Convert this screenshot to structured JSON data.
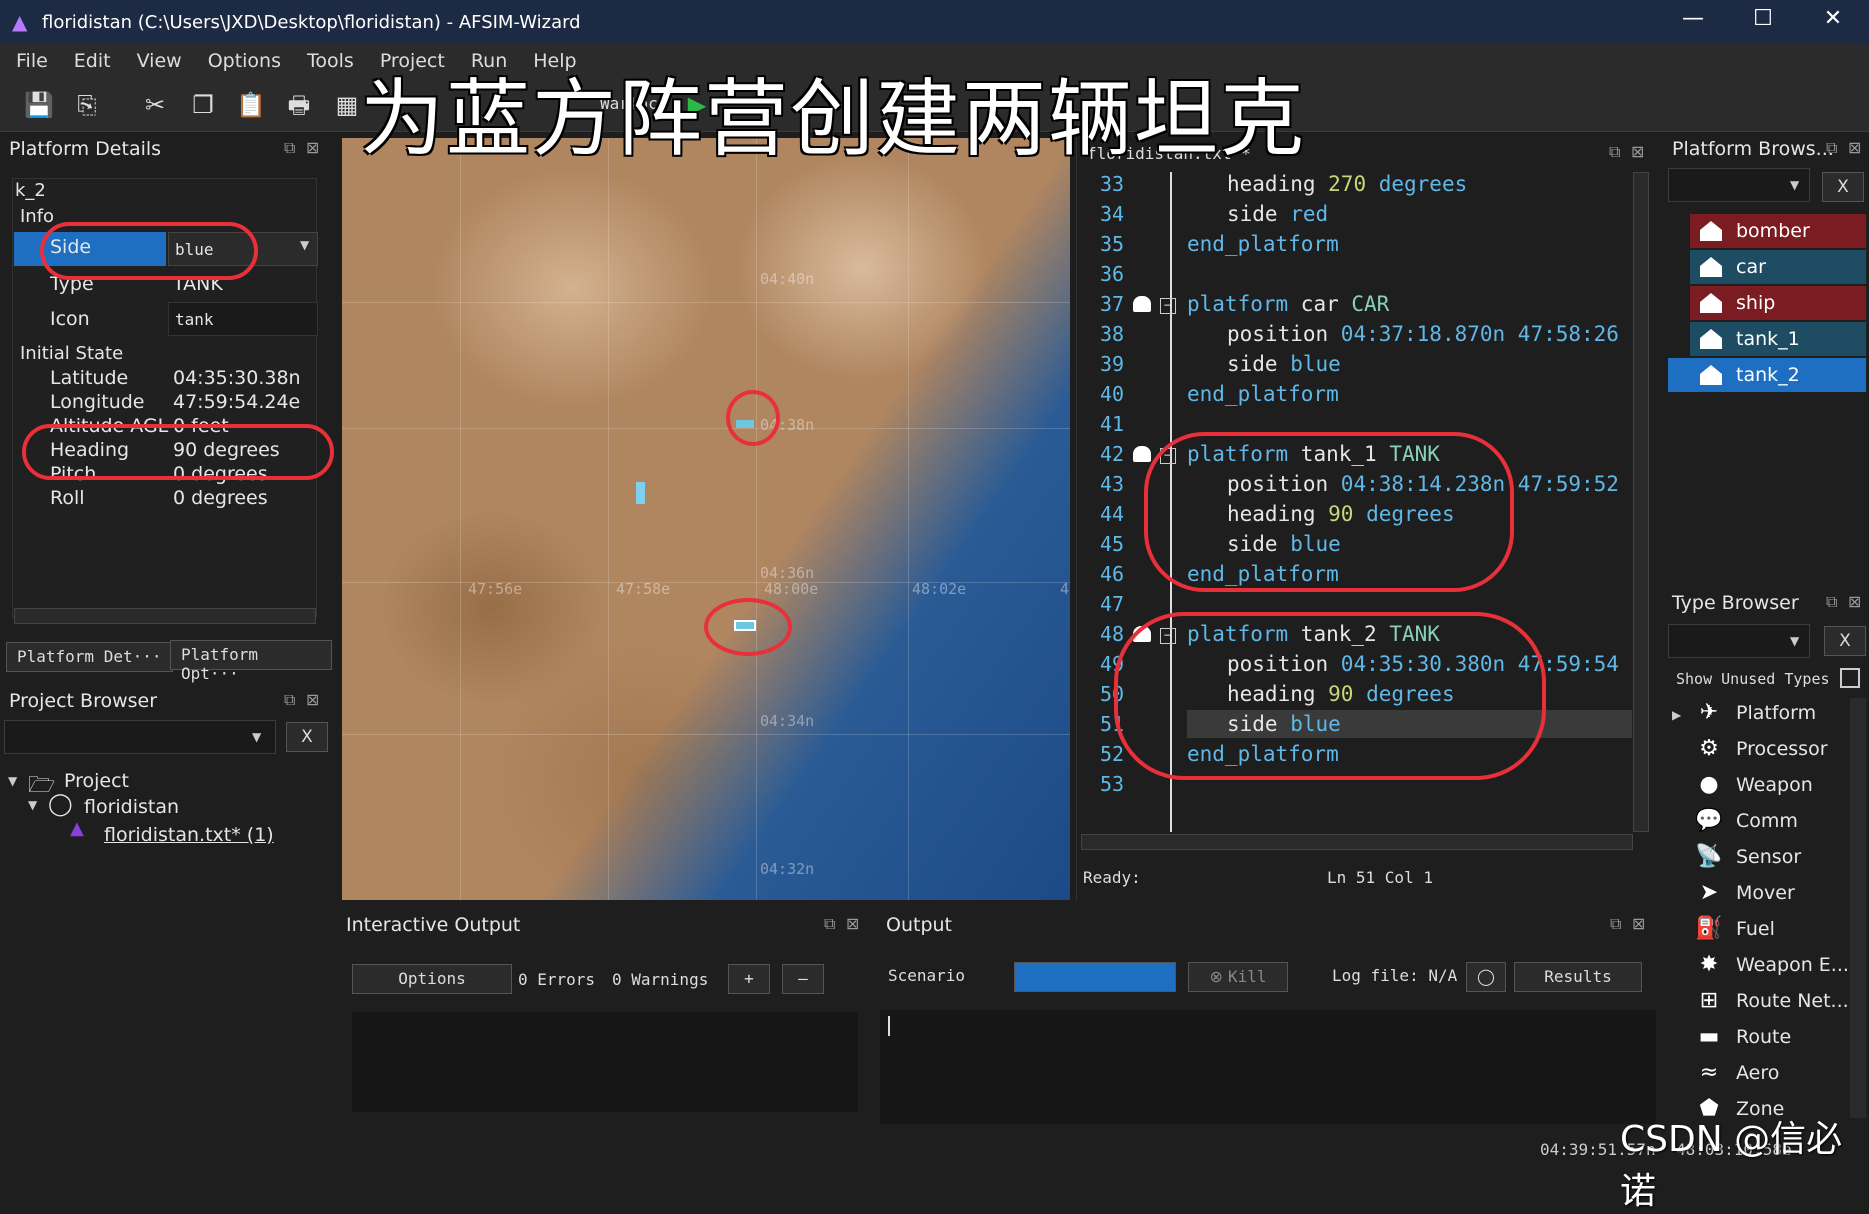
{
  "window": {
    "title": "floridistan (C:\\Users\\JXD\\Desktop\\floridistan) - AFSIM-Wizard",
    "minimize": "—",
    "maximize": "☐",
    "close": "✕"
  },
  "menu": [
    "File",
    "Edit",
    "View",
    "Options",
    "Tools",
    "Project",
    "Run",
    "Help"
  ],
  "toolbar": {
    "warlock": "Warlock"
  },
  "overlay_caption": "为蓝方阵营创建两辆坦克",
  "platform_details": {
    "title": "Platform Details",
    "name": "k_2",
    "info_header": "Info",
    "rows": [
      {
        "label": "Side",
        "value": "blue"
      },
      {
        "label": "Type",
        "value": "TANK"
      },
      {
        "label": "Icon",
        "value": "tank"
      }
    ],
    "initial_state_header": "Initial State",
    "state": [
      {
        "label": "Latitude",
        "value": "04:35:30.38n"
      },
      {
        "label": "Longitude",
        "value": "47:59:54.24e"
      },
      {
        "label": "Altitude AGL",
        "value": "0 feet"
      },
      {
        "label": "Heading",
        "value": "90 degrees"
      },
      {
        "label": "Pitch",
        "value": "0 degrees"
      },
      {
        "label": "Roll",
        "value": "0 degrees"
      }
    ],
    "tabs": [
      "Platform Det···",
      "Platform Opt···"
    ]
  },
  "project_browser": {
    "title": "Project Browser",
    "clear": "X",
    "tree": [
      "Project",
      "floridistan",
      "floridistan.txt* (1)"
    ]
  },
  "map": {
    "labels": {
      "lat1": "04:40n",
      "lat2": "04:38n",
      "lat3": "04:36n",
      "lat4": "04:34n",
      "lat5": "04:32n",
      "lon1": "47:56e",
      "lon2": "47:58e",
      "lon3": "48:00e",
      "lon4": "48:02e",
      "lon5": "4"
    }
  },
  "editor": {
    "filename": "floridistan.txt *",
    "lines": [
      {
        "n": "33"
      },
      {
        "n": "34"
      },
      {
        "n": "35"
      },
      {
        "n": "36"
      },
      {
        "n": "37"
      },
      {
        "n": "38"
      },
      {
        "n": "39"
      },
      {
        "n": "40"
      },
      {
        "n": "41"
      },
      {
        "n": "42"
      },
      {
        "n": "43"
      },
      {
        "n": "44"
      },
      {
        "n": "45"
      },
      {
        "n": "46"
      },
      {
        "n": "47"
      },
      {
        "n": "48"
      },
      {
        "n": "49"
      },
      {
        "n": "50"
      },
      {
        "n": "51"
      },
      {
        "n": "52"
      },
      {
        "n": "53"
      }
    ],
    "code": {
      "l33a": "heading ",
      "l33b": "270",
      "l33c": " degrees",
      "l34a": "side ",
      "l34b": "red",
      "end": "end_platform",
      "platform_kw": "platform ",
      "l37name": "car ",
      "l37type": "CAR",
      "position_kw": "position ",
      "l38pos": "04:37:18.870n 47:58:26",
      "side_kw": "side ",
      "blue": "blue",
      "l42name": "tank_1 ",
      "l42type": "TANK",
      "l43pos": "04:38:14.238n 47:59:52",
      "heading_kw": "heading ",
      "ninety": "90",
      "degrees": " degrees",
      "l48name": "tank_2 ",
      "l48type": "TANK",
      "l49pos": "04:35:30.380n 47:59:54"
    },
    "status": {
      "ready": "Ready:",
      "pos": "Ln 51  Col 1"
    }
  },
  "platform_browser": {
    "title": "Platform Brows...",
    "clear": "X",
    "items": [
      {
        "name": "bomber",
        "color": "#7a1c22"
      },
      {
        "name": "car",
        "color": "#1e4d63"
      },
      {
        "name": "ship",
        "color": "#7a1c22"
      },
      {
        "name": "tank_1",
        "color": "#1e4d63"
      },
      {
        "name": "tank_2",
        "color": "#1e6fc2"
      }
    ]
  },
  "type_browser": {
    "title": "Type Browser",
    "clear": "X",
    "show_unused": "Show Unused Types",
    "items": [
      {
        "name": "Platform",
        "icon": "✈"
      },
      {
        "name": "Processor",
        "icon": "⚙"
      },
      {
        "name": "Weapon",
        "icon": "●"
      },
      {
        "name": "Comm",
        "icon": "💬"
      },
      {
        "name": "Sensor",
        "icon": "📡"
      },
      {
        "name": "Mover",
        "icon": "➤"
      },
      {
        "name": "Fuel",
        "icon": "⛽"
      },
      {
        "name": "Weapon E...",
        "icon": "✸"
      },
      {
        "name": "Route Net...",
        "icon": "⊞"
      },
      {
        "name": "Route",
        "icon": "▬"
      },
      {
        "name": "Aero",
        "icon": "≈"
      },
      {
        "name": "Zone",
        "icon": "⬟"
      }
    ]
  },
  "interactive_output": {
    "title": "Interactive Output",
    "options": "Options",
    "errors": "0 Errors",
    "warnings": "0 Warnings",
    "plus": "+",
    "minus": "–"
  },
  "output": {
    "title": "Output",
    "scenario": "Scenario",
    "kill": "Kill",
    "logfile": "Log file: N/A",
    "results": "Results"
  },
  "footer_coords": {
    "lat": "04:39:51.57n",
    "lon": "48:03:10.58e"
  },
  "watermark": "CSDN @信必诺",
  "colors": {
    "accent": "#1e6fc2",
    "annotation": "#e8303a",
    "code_keyword": "#5fb8e8",
    "code_number": "#c5d97a"
  }
}
